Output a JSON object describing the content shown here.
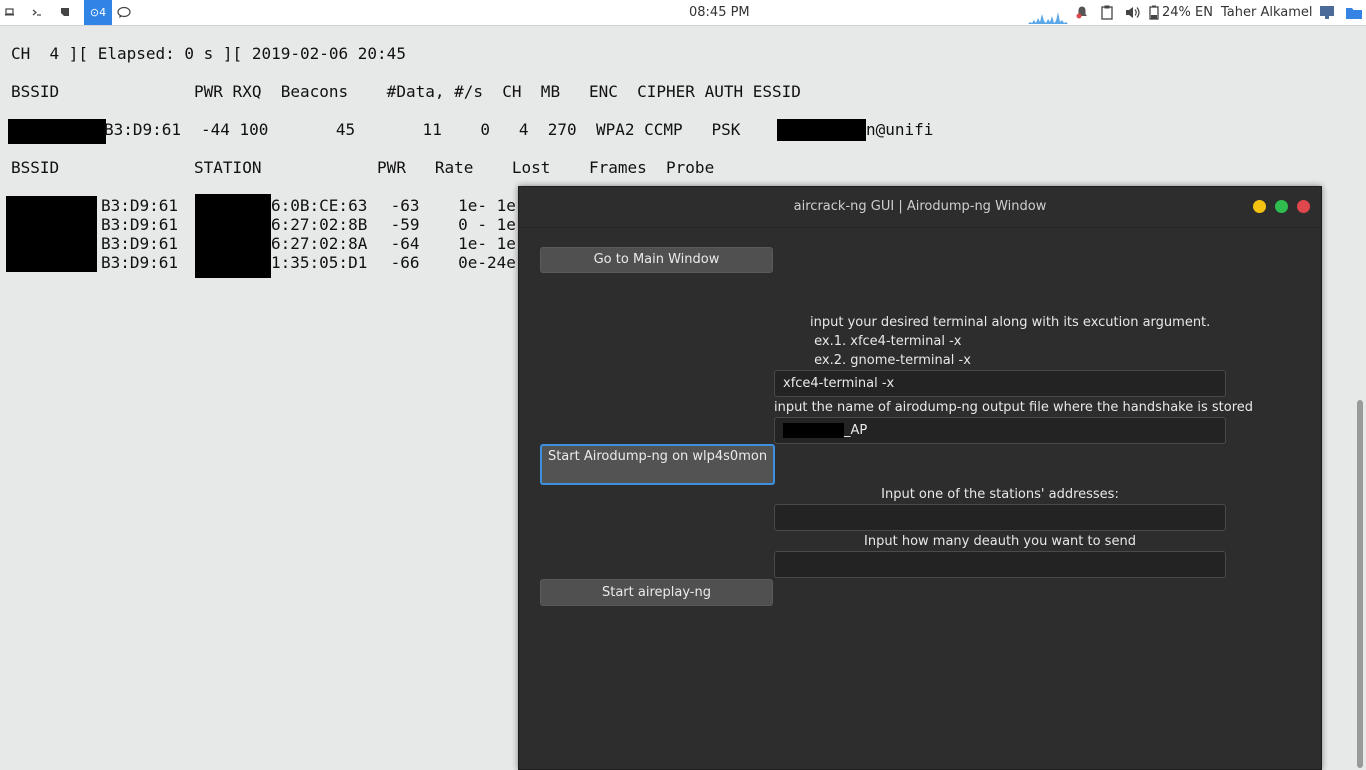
{
  "panel": {
    "workspace_active": "4",
    "clock": "08:45 PM",
    "battery": "24%",
    "language": "EN",
    "user": "Taher Alkamel"
  },
  "terminal": {
    "status_line": "CH  4 ][ Elapsed: 0 s ][ 2019-02-06 20:45",
    "ap_header": "BSSID              PWR RXQ  Beacons    #Data, #/s  CH  MB   ENC  CIPHER AUTH ESSID",
    "ap_row_bssid": "B3:D9:61",
    "ap_row_values": "-44 100       45       11    0   4  270  WPA2 CCMP   PSK",
    "ap_row_essid": "n@unifi",
    "station_header": "BSSID              STATION            PWR   Rate    Lost    Frames  Probe",
    "stations": [
      {
        "bssid": "B3:D9:61",
        "station": "6:0B:CE:63",
        "rest": " -63    1e- 1e"
      },
      {
        "bssid": "B3:D9:61",
        "station": "6:27:02:8B",
        "rest": " -59    0 - 1e"
      },
      {
        "bssid": "B3:D9:61",
        "station": "6:27:02:8A",
        "rest": " -64    1e- 1e"
      },
      {
        "bssid": "B3:D9:61",
        "station": "1:35:05:D1",
        "rest": " -66    0e-24e"
      }
    ]
  },
  "window": {
    "title": "aircrack-ng GUI | Airodump-ng Window",
    "go_main_label": "Go to Main Window",
    "terminal_prompt_line1": "input your desired terminal along with its excution argument.",
    "terminal_prompt_line2": " ex.1. xfce4-terminal -x",
    "terminal_prompt_line3": " ex.2. gnome-terminal -x",
    "terminal_input_value": "xfce4-terminal -x",
    "output_file_label": "input the name of airodump-ng output file where the handshake is stored",
    "output_file_value": "_AP",
    "start_airodump_label": "Start Airodump-ng on wlp4s0mon",
    "station_label": "Input one of the stations' addresses:",
    "station_value": "",
    "deauth_label": "Input how many deauth you want to send",
    "deauth_value": "",
    "start_aireplay_label": "Start aireplay-ng"
  },
  "colors": {
    "accent": "#3d8fe0",
    "close": "#e0474c",
    "minimize": "#f5c211",
    "maximize": "#2ebd4e"
  }
}
